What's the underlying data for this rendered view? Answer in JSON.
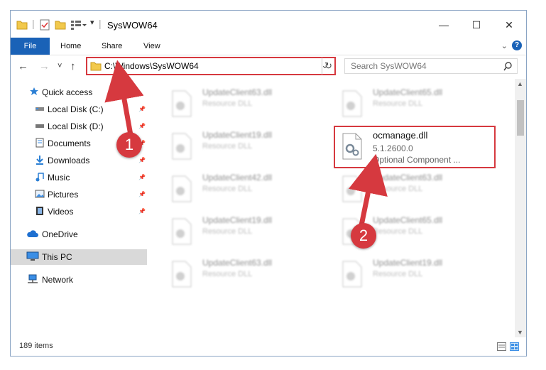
{
  "window": {
    "title": "SysWOW64",
    "minimize": "—",
    "maximize": "☐",
    "close": "✕"
  },
  "ribbon": {
    "file": "File",
    "tabs": [
      "Home",
      "Share",
      "View"
    ],
    "help": "?"
  },
  "nav": {
    "back": "←",
    "forward": "→",
    "recent": "˅",
    "up": "↑",
    "address": "C:\\Windows\\SysWOW64",
    "dropdown": "⌄",
    "refresh": "↻",
    "search_placeholder": "Search SysWOW64",
    "search_icon": "⌕"
  },
  "sidebar": {
    "items": [
      {
        "label": "Quick access",
        "icon": "star-icon"
      },
      {
        "label": "Local Disk (C:)",
        "icon": "drive-icon"
      },
      {
        "label": "Local Disk (D:)",
        "icon": "drive-icon"
      },
      {
        "label": "Documents",
        "icon": "documents-icon"
      },
      {
        "label": "Downloads",
        "icon": "download-icon"
      },
      {
        "label": "Music",
        "icon": "music-icon"
      },
      {
        "label": "Pictures",
        "icon": "pictures-icon"
      },
      {
        "label": "Videos",
        "icon": "videos-icon"
      },
      {
        "label": "OneDrive",
        "icon": "cloud-icon"
      },
      {
        "label": "This PC",
        "icon": "computer-icon"
      },
      {
        "label": "Network",
        "icon": "network-icon"
      }
    ]
  },
  "files": {
    "left": [
      {
        "name": "UpdateClient63.dll",
        "sub": "Resource DLL"
      },
      {
        "name": "UpdateClient19.dll",
        "sub": "Resource DLL"
      },
      {
        "name": "UpdateClient42.dll",
        "sub": "Resource DLL"
      },
      {
        "name": "UpdateClient19.dll",
        "sub": "Resource DLL"
      },
      {
        "name": "UpdateClient63.dll",
        "sub": "Resource DLL"
      }
    ],
    "right": [
      {
        "name": "UpdateClient65.dll",
        "sub": "Resource DLL"
      },
      {
        "name": "UpdateClient63.dll",
        "sub": "Resource DLL"
      },
      {
        "name": "UpdateClient65.dll",
        "sub": "Resource DLL"
      },
      {
        "name": "UpdateClient19.dll",
        "sub": "Resource DLL"
      }
    ],
    "target": {
      "name": "ocmanage.dll",
      "version": "5.1.2600.0",
      "desc": "Optional Component ..."
    }
  },
  "status": {
    "count": "189 items"
  },
  "annotations": {
    "step1": "1",
    "step2": "2"
  },
  "colors": {
    "accent": "#1a62b7",
    "highlight": "#d6393f"
  }
}
